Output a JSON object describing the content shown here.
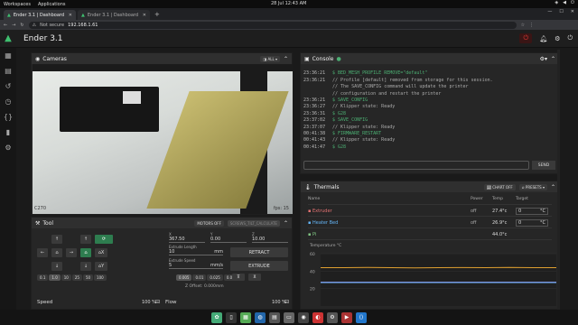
{
  "system": {
    "workspaces": "Workspaces",
    "applications": "Applications",
    "clock": "28 Jul  12:43 AM"
  },
  "browser": {
    "tabs": [
      {
        "label": "Ender 3.1 | Dashboard"
      },
      {
        "label": "Ender 3.1 | Dashboard"
      }
    ],
    "new_tab": "+",
    "security": "Not secure",
    "url": "192.168.1.61"
  },
  "app": {
    "title": "Ender 3.1"
  },
  "cameras": {
    "title": "Cameras",
    "filter": "ALL",
    "fps": "fps: 15",
    "camera_name": "C270"
  },
  "tool": {
    "title": "Tool",
    "motors_off": "MOTORS OFF",
    "screws_tilt": "SCREWS_TILT_CALCULATE",
    "x_label": "X",
    "x_value": "367.50",
    "y_label": "Y",
    "y_value": "0.00",
    "z_label": "Z",
    "z_value": "10.00",
    "extrude_length_label": "Extrude Length",
    "extrude_length": "10",
    "extrude_length_unit": "mm",
    "extrude_speed_label": "Extrude Speed",
    "extrude_speed": "5",
    "extrude_speed_unit": "mm/s",
    "retract": "RETRACT",
    "extrude": "EXTRUDE",
    "steps": [
      "0.1",
      "1.0",
      "10",
      "25",
      "50",
      "100"
    ],
    "offsets": [
      "0.005",
      "0.01",
      "0.025",
      "0.05"
    ],
    "z_offset": "Z Offset: 0.000mm",
    "home_x": "X",
    "home_y": "Y",
    "speed_label": "Speed",
    "speed_value": "100 %",
    "flow_label": "Flow",
    "flow_value": "100 %"
  },
  "console": {
    "title": "Console",
    "send": "SEND",
    "lines": [
      {
        "time": "",
        "text": "",
        "kind": "m"
      },
      {
        "time": "23:36:21",
        "text": "$ BED_MESH_PROFILE REMOVE=\"default\"",
        "kind": "g"
      },
      {
        "time": "23:36:21",
        "text": "// Profile [default] removed from storage for this session.",
        "kind": "m"
      },
      {
        "time": "",
        "text": "// The SAVE_CONFIG command will update the printer",
        "kind": "m"
      },
      {
        "time": "",
        "text": "// configuration and restart the printer",
        "kind": "m"
      },
      {
        "time": "23:36:21",
        "text": "$ SAVE_CONFIG",
        "kind": "g"
      },
      {
        "time": "23:36:27",
        "text": "// Klipper state: Ready",
        "kind": "m"
      },
      {
        "time": "23:36:31",
        "text": "$ G28",
        "kind": "g"
      },
      {
        "time": "23:37:02",
        "text": "$ SAVE_CONFIG",
        "kind": "g"
      },
      {
        "time": "23:37:07",
        "text": "// Klipper state: Ready",
        "kind": "m"
      },
      {
        "time": "00:41:38",
        "text": "$ FIRMWARE_RESTART",
        "kind": "g"
      },
      {
        "time": "00:41:43",
        "text": "// Klipper state: Ready",
        "kind": "m"
      },
      {
        "time": "00:41:47",
        "text": "$ G28",
        "kind": "g"
      }
    ]
  },
  "thermals": {
    "title": "Thermals",
    "chart_off": "CHART OFF",
    "presets": "PRESETS",
    "headers": {
      "name": "Name",
      "power": "Power",
      "temp": "Temp",
      "target": "Target"
    },
    "rows": [
      {
        "name": "Extruder",
        "power": "off",
        "temp": "27.4°c",
        "target": "0",
        "unit": "°C",
        "color": "#e57373"
      },
      {
        "name": "Heater Bed",
        "power": "off",
        "temp": "26.9°c",
        "target": "0",
        "unit": "°C",
        "color": "#64b5f6"
      },
      {
        "name": "Pi",
        "power": "",
        "temp": "44.0°c",
        "target": "",
        "unit": "",
        "color": "#81c784"
      }
    ],
    "graph_label": "Temperature °C",
    "y_ticks": [
      "60",
      "40",
      "20"
    ]
  },
  "chart_data": {
    "type": "line",
    "ylabel": "Temperature °C",
    "ylim": [
      0,
      60
    ],
    "series": [
      {
        "name": "Pi",
        "values": [
          44,
          44,
          44.2,
          44,
          43.8,
          44,
          44.1,
          44,
          44.3,
          44,
          44
        ]
      },
      {
        "name": "Extruder",
        "values": [
          27.4,
          27.4,
          27.4,
          27.4,
          27.4,
          27.4,
          27.4,
          27.4,
          27.4,
          27.4,
          27.4
        ]
      },
      {
        "name": "Heater Bed",
        "values": [
          26.9,
          26.9,
          26.9,
          26.9,
          26.9,
          26.9,
          26.9,
          26.9,
          26.9,
          26.9,
          26.9
        ]
      }
    ],
    "colors": [
      "#e0a030",
      "#9575cd",
      "#64b5f6"
    ]
  }
}
